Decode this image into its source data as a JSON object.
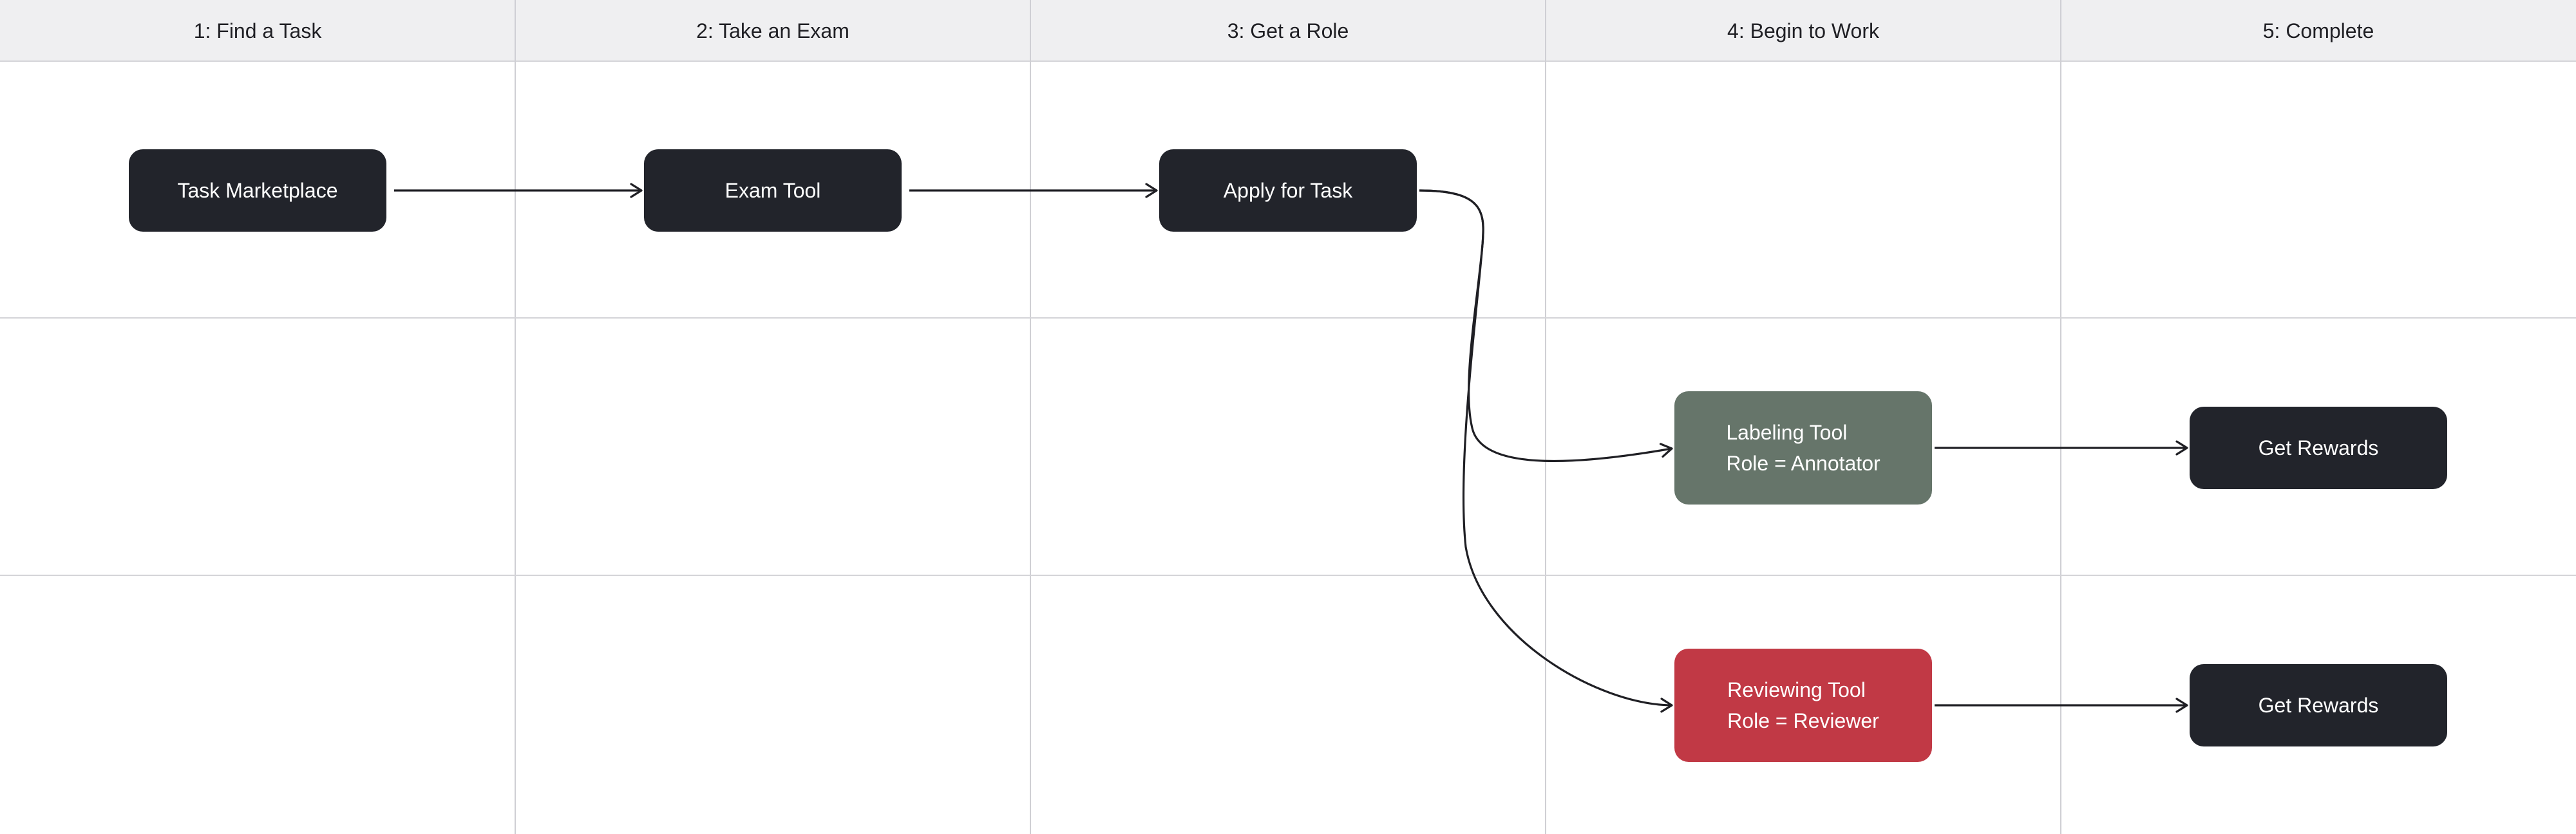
{
  "columns": [
    {
      "label": "1: Find a Task"
    },
    {
      "label": "2: Take an Exam"
    },
    {
      "label": "3: Get a Role"
    },
    {
      "label": "4: Begin to Work"
    },
    {
      "label": "5: Complete"
    }
  ],
  "nodes": {
    "task_marketplace": {
      "label": "Task Marketplace",
      "color": "#22242b"
    },
    "exam_tool": {
      "label": "Exam Tool",
      "color": "#22242b"
    },
    "apply_for_task": {
      "label": "Apply for Task",
      "color": "#22242b"
    },
    "labeling_tool": {
      "line1": "Labeling Tool",
      "line2": "Role = Annotator",
      "color": "#66756a"
    },
    "reviewing_tool": {
      "line1": "Reviewing Tool",
      "line2": "Role = Reviewer",
      "color": "#c13945"
    },
    "get_rewards_annotator": {
      "label": "Get Rewards",
      "color": "#22242b"
    },
    "get_rewards_reviewer": {
      "label": "Get Rewards",
      "color": "#22242b"
    }
  },
  "edges": [
    {
      "from": "Task Marketplace",
      "to": "Exam Tool"
    },
    {
      "from": "Exam Tool",
      "to": "Apply for Task"
    },
    {
      "from": "Apply for Task",
      "to": "Labeling Tool"
    },
    {
      "from": "Apply for Task",
      "to": "Reviewing Tool"
    },
    {
      "from": "Labeling Tool",
      "to": "Get Rewards"
    },
    {
      "from": "Reviewing Tool",
      "to": "Get Rewards"
    }
  ]
}
